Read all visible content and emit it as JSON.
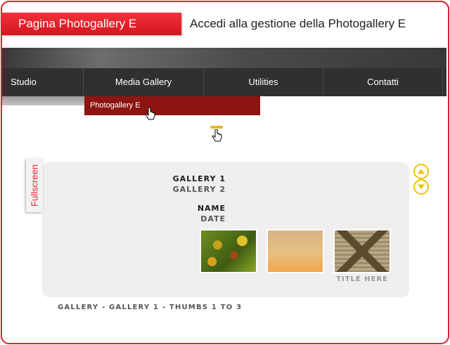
{
  "header": {
    "page_tab_label": "Pagina Photogallery E",
    "page_heading": "Accedi alla gestione della Photogallery E"
  },
  "nav": {
    "items": [
      {
        "label": "Studio"
      },
      {
        "label": "Media Gallery"
      },
      {
        "label": "Utilities"
      },
      {
        "label": "Contatti"
      }
    ],
    "dropdown_item": "Photogallery E"
  },
  "gallery": {
    "fullscreen_label": "Fullscreen",
    "galleries": [
      "GALLERY 1",
      "GALLERY 2"
    ],
    "name_label": "NAME",
    "date_label": "DATE",
    "thumb_title": "TITLE HERE",
    "caption": "GALLERY - GALLERY 1 - THUMBS 1 TO 3"
  },
  "colors": {
    "accent_red": "#d9232d",
    "dropdown_dark_red": "#8c1512",
    "navbar": "#303030",
    "arrow_yellow": "#f2c20e"
  },
  "icons": {
    "cursor": "hand-pointer-icon",
    "edit": "pencil-icon",
    "scroll_up": "arrow-up-icon",
    "scroll_down": "arrow-down-icon"
  }
}
